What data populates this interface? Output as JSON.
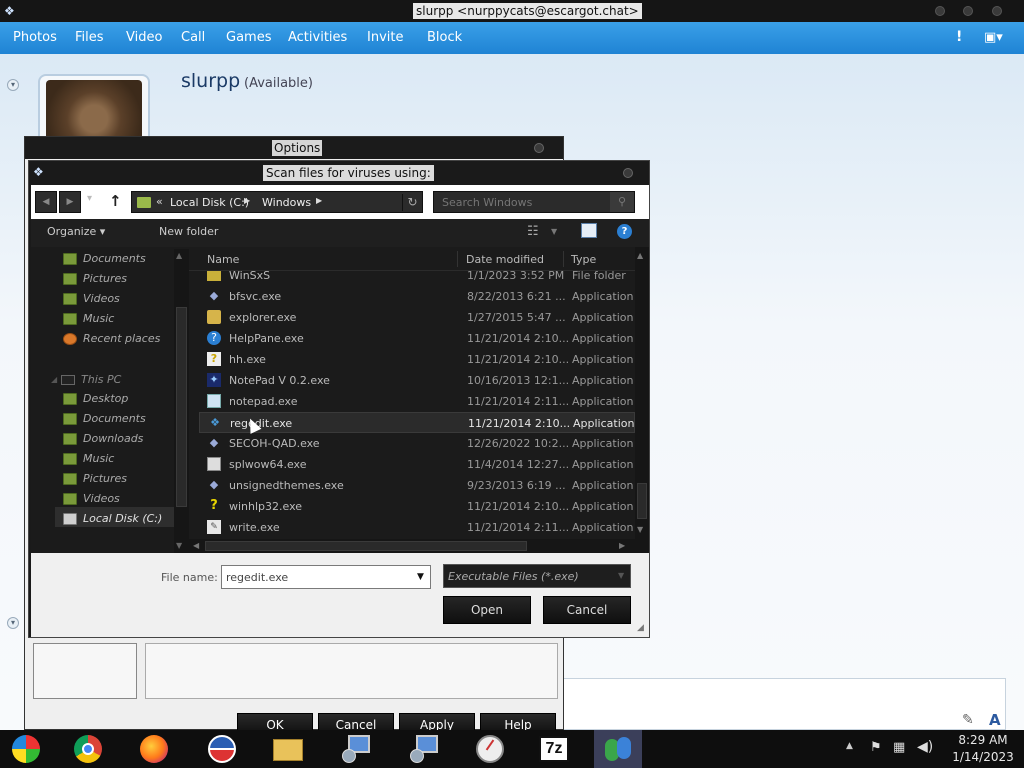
{
  "messenger": {
    "title": "slurpp <nurppycats@escargot.chat>",
    "menu": [
      "Photos",
      "Files",
      "Video",
      "Call",
      "Games",
      "Activities",
      "Invite",
      "Block"
    ],
    "alert_icon": "!",
    "contact_name": "slurpp",
    "contact_status": "(Available)",
    "status_color": "#6dc64e",
    "accent_color": "#1f83d4"
  },
  "options_dialog": {
    "title": "Options",
    "buttons": [
      "OK",
      "Cancel",
      "Apply",
      "Help"
    ]
  },
  "file_dialog": {
    "title": "Scan files for viruses using:",
    "address": {
      "prefix": "«",
      "segments": [
        "Local Disk (C:)",
        "Windows"
      ]
    },
    "search_placeholder": "Search Windows",
    "toolbar": {
      "organize": "Organize",
      "new_folder": "New folder"
    },
    "nav_items": [
      {
        "label": "Documents",
        "icon": "documents-folder-icon"
      },
      {
        "label": "Pictures",
        "icon": "pictures-folder-icon"
      },
      {
        "label": "Videos",
        "icon": "videos-folder-icon"
      },
      {
        "label": "Music",
        "icon": "music-folder-icon"
      },
      {
        "label": "Recent places",
        "icon": "recent-places-icon"
      },
      {
        "label": "This PC",
        "icon": "pc-icon"
      },
      {
        "label": "Desktop",
        "icon": "desktop-folder-icon"
      },
      {
        "label": "Documents",
        "icon": "documents-folder-icon"
      },
      {
        "label": "Downloads",
        "icon": "downloads-folder-icon"
      },
      {
        "label": "Music",
        "icon": "music-folder-icon"
      },
      {
        "label": "Pictures",
        "icon": "pictures-folder-icon"
      },
      {
        "label": "Videos",
        "icon": "videos-folder-icon"
      },
      {
        "label": "Local Disk (C:)",
        "icon": "local-disk-icon"
      }
    ],
    "columns": [
      "Name",
      "Date modified",
      "Type"
    ],
    "files": [
      {
        "name": "WinSxS",
        "date": "1/1/2023 3:52 PM",
        "type": "File folder",
        "icon": "folder-icon"
      },
      {
        "name": "bfsvc.exe",
        "date": "8/22/2013 6:21 ...",
        "type": "Application",
        "icon": "app-icon"
      },
      {
        "name": "explorer.exe",
        "date": "1/27/2015 5:47 ...",
        "type": "Application",
        "icon": "explorer-icon"
      },
      {
        "name": "HelpPane.exe",
        "date": "11/21/2014 2:10...",
        "type": "Application",
        "icon": "help-icon"
      },
      {
        "name": "hh.exe",
        "date": "11/21/2014 2:10...",
        "type": "Application",
        "icon": "help-doc-icon"
      },
      {
        "name": "NotePad V 0.2.exe",
        "date": "10/16/2013 12:1...",
        "type": "Application",
        "icon": "notepad-custom-icon"
      },
      {
        "name": "notepad.exe",
        "date": "11/21/2014 2:11...",
        "type": "Application",
        "icon": "notepad-icon"
      },
      {
        "name": "regedit.exe",
        "date": "11/21/2014 2:10...",
        "type": "Application",
        "icon": "registry-icon"
      },
      {
        "name": "SECOH-QAD.exe",
        "date": "12/26/2022 10:2...",
        "type": "Application",
        "icon": "app-icon"
      },
      {
        "name": "splwow64.exe",
        "date": "11/4/2014 12:27...",
        "type": "Application",
        "icon": "printer-icon"
      },
      {
        "name": "unsignedthemes.exe",
        "date": "9/23/2013 6:19 ...",
        "type": "Application",
        "icon": "app-icon"
      },
      {
        "name": "winhlp32.exe",
        "date": "11/21/2014 2:10...",
        "type": "Application",
        "icon": "help-question-icon"
      },
      {
        "name": "write.exe",
        "date": "11/21/2014 2:11...",
        "type": "Application",
        "icon": "write-icon"
      }
    ],
    "selected_file": "regedit.exe",
    "filename_label": "File name:",
    "filename_value": "regedit.exe",
    "filetype": "Executable Files (*.exe)",
    "open_label": "Open",
    "cancel_label": "Cancel"
  },
  "taskbar": {
    "apps": [
      "windows-start-icon",
      "chrome-icon",
      "firefox-icon",
      "obama-logo-icon",
      "file-explorer-icon",
      "network-setup-icon",
      "network-setup-icon",
      "clock-app-icon",
      "7zip-icon",
      "messenger-icon"
    ],
    "app_7z_label": "7z",
    "time": "8:29 AM",
    "date": "1/14/2023"
  }
}
